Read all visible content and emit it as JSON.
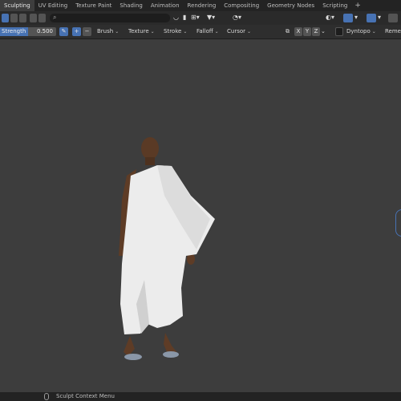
{
  "workspace_tabs": [
    {
      "label": "Sculpting",
      "active": true
    },
    {
      "label": "UV Editing",
      "active": false
    },
    {
      "label": "Texture Paint",
      "active": false
    },
    {
      "label": "Shading",
      "active": false
    },
    {
      "label": "Animation",
      "active": false
    },
    {
      "label": "Rendering",
      "active": false
    },
    {
      "label": "Compositing",
      "active": false
    },
    {
      "label": "Geometry Nodes",
      "active": false
    },
    {
      "label": "Scripting",
      "active": false
    }
  ],
  "add_tab_label": "+",
  "tool_settings": {
    "strength_label": "Strength",
    "strength_value": "0.500",
    "strength_fraction": 0.5,
    "plus": "+",
    "minus": "−",
    "menus": [
      "Brush",
      "Texture",
      "Stroke",
      "Falloff",
      "Cursor"
    ],
    "axis_x": "X",
    "axis_y": "Y",
    "axis_z": "Z",
    "dyntopo": "Dyntopo",
    "remesh": "Reme"
  },
  "status_bar": {
    "context_menu": "Sculpt Context Menu"
  },
  "colors": {
    "accent": "#4772b3",
    "viewport": "#3d3d3d"
  }
}
